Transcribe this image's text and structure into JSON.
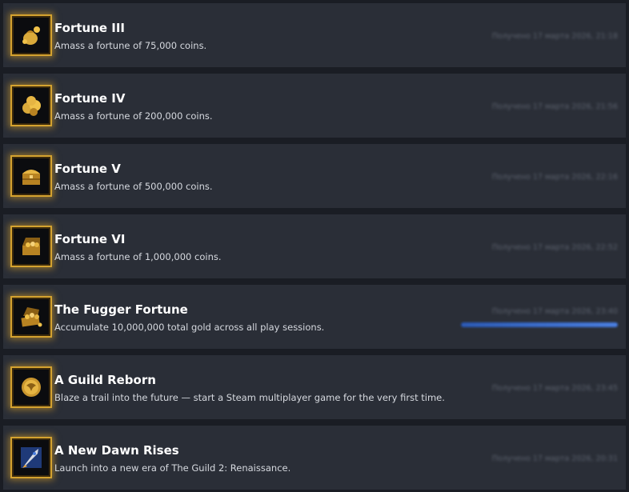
{
  "achievements": [
    {
      "title": "Fortune III",
      "description": "Amass a fortune of 75,000 coins.",
      "unlock_text": "Получено 17 марта 2026, 21:18",
      "icon": "coin-pouch-icon"
    },
    {
      "title": "Fortune IV",
      "description": "Amass a fortune of 200,000 coins.",
      "unlock_text": "Получено 17 марта 2026, 21:56",
      "icon": "coin-pile-icon"
    },
    {
      "title": "Fortune V",
      "description": "Amass a fortune of 500,000 coins.",
      "unlock_text": "Получено 17 марта 2026, 22:16",
      "icon": "treasure-chest-icon"
    },
    {
      "title": "Fortune VI",
      "description": "Amass a fortune of 1,000,000 coins.",
      "unlock_text": "Получено 17 марта 2026, 22:52",
      "icon": "treasure-chest-open-icon"
    },
    {
      "title": "The Fugger Fortune",
      "description": "Accumulate 10,000,000 total gold across all play sessions.",
      "unlock_text": "Получено 17 марта 2026, 23:40",
      "icon": "overflowing-chest-icon",
      "progress": 1.0,
      "progress_color": "#3d6fd0"
    },
    {
      "title": "A Guild Reborn",
      "description": "Blaze a trail into the future — start a Steam multiplayer game for the very first time.",
      "unlock_text": "Получено 17 марта 2026, 23:45",
      "icon": "guild-emblem-icon"
    },
    {
      "title": "A New Dawn Rises",
      "description": "Launch into a new era of The Guild 2: Renaissance.",
      "unlock_text": "Получено 17 марта 2026, 20:31",
      "icon": "rocket-icon"
    }
  ],
  "colors": {
    "background": "#1a1d24",
    "row": "#2a2e37",
    "frame_gold": "#d4a22f",
    "title": "#ffffff",
    "description": "#d6d9df"
  }
}
